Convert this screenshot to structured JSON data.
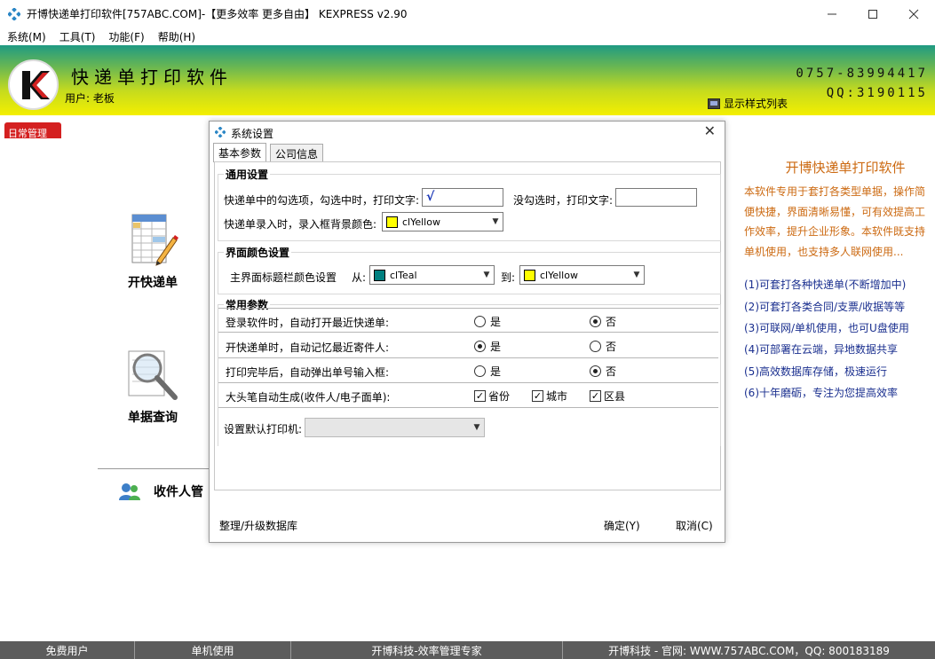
{
  "window": {
    "title": "开博快递单打印软件[757ABC.COM]-【更多效率 更多自由】  KEXPRESS v2.90",
    "minimize_icon": "minimize-icon",
    "maximize_icon": "maximize-icon",
    "close_icon": "close-icon"
  },
  "menu": [
    "系统(M)",
    "工具(T)",
    "功能(F)",
    "帮助(H)"
  ],
  "banner": {
    "brand": "快递单打印软件",
    "user": "用户: 老板",
    "phone": "0757-83994417",
    "qq": "QQ:3190115",
    "style_list": "显示样式列表",
    "colors": {
      "top": "#1f9a83",
      "bottom": "#f4ef00"
    }
  },
  "left_tab": "日常管理",
  "functions": {
    "open_waybill": "开快递单",
    "query": "单据查询",
    "receiver": "收件人管"
  },
  "description": {
    "heading": "开博快递单打印软件",
    "intro": "本软件专用于套打各类型单据，操作简便快捷，界面清晰易懂，可有效提高工作效率，提升企业形象。本软件既支持单机使用，也支持多人联网使用...",
    "features": [
      "(1)可套打各种快递单(不断增加中)",
      "(2)可套打各类合同/支票/收据等等",
      "(3)可联网/单机使用，也可U盘使用",
      "(4)可部署在云端，异地数据共享",
      "(5)高效数据库存储，极速运行",
      "(6)十年磨砺，专注为您提高效率"
    ],
    "colors": {
      "heading": "#cc6a12",
      "features": "#1a2f8f"
    }
  },
  "dialog": {
    "title": "系统设置",
    "tabs": [
      "基本参数",
      "公司信息"
    ],
    "general": {
      "heading": "通用设置",
      "checked_label": "快递单中的勾选项，勾选中时，打印文字:",
      "checked_value": "√",
      "unchecked_label": "没勾选时，打印文字:",
      "unchecked_value": "",
      "bg_label": "快递单录入时，录入框背景颜色:",
      "bg_value": "clYellow",
      "bg_color": "#ffff00"
    },
    "ui_color": {
      "heading": "界面颜色设置",
      "label": "主界面标题栏颜色设置",
      "from_label": "从:",
      "from_value": "clTeal",
      "from_color": "#008080",
      "to_label": "到:",
      "to_value": "clYellow",
      "to_color": "#ffff00"
    },
    "common": {
      "heading": "常用参数",
      "yes": "是",
      "no": "否",
      "rows": [
        {
          "label": "登录软件时，自动打开最近快递单:",
          "selected": "否"
        },
        {
          "label": "开快递单时，自动记忆最近寄件人:",
          "selected": "是"
        },
        {
          "label": "打印完毕后，自动弹出单号输入框:",
          "selected": "否"
        }
      ],
      "capital_label": "大头笔自动生成(收件人/电子面单):",
      "capital_options": [
        "省份",
        "城市",
        "区县"
      ],
      "printer_label": "设置默认打印机:",
      "printer_value": ""
    },
    "footer": {
      "upgrade": "整理/升级数据库",
      "ok": "确定(Y)",
      "cancel": "取消(C)"
    }
  },
  "status": [
    "免费用户",
    "单机使用",
    "开博科技-效率管理专家",
    "开博科技 - 官网: WWW.757ABC.COM，QQ: 800183189"
  ]
}
